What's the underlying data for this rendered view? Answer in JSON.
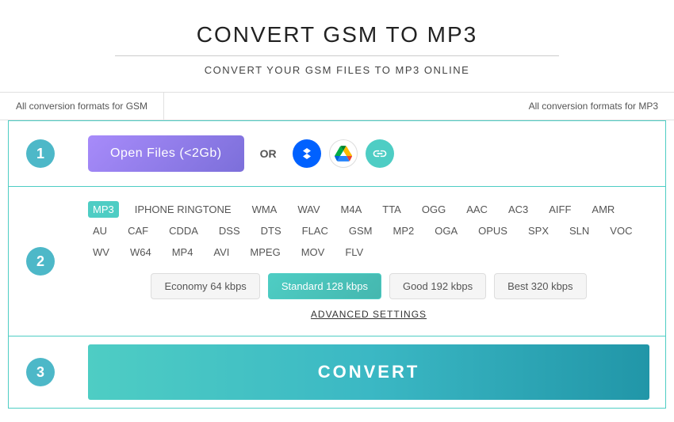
{
  "header": {
    "title": "CONVERT GSM TO MP3",
    "subtitle": "CONVERT YOUR GSM FILES TO MP3 ONLINE"
  },
  "tabs": [
    {
      "label": "All conversion formats for GSM"
    },
    {
      "label": "All conversion formats for MP3"
    }
  ],
  "step1": {
    "open_btn_label": "Open Files (<2Gb)",
    "or_label": "OR"
  },
  "step2": {
    "formats": [
      {
        "label": "MP3",
        "active": true
      },
      {
        "label": "IPHONE RINGTONE",
        "active": false
      },
      {
        "label": "WMA",
        "active": false
      },
      {
        "label": "WAV",
        "active": false
      },
      {
        "label": "M4A",
        "active": false
      },
      {
        "label": "TTA",
        "active": false
      },
      {
        "label": "OGG",
        "active": false
      },
      {
        "label": "AAC",
        "active": false
      },
      {
        "label": "AC3",
        "active": false
      },
      {
        "label": "AIFF",
        "active": false
      },
      {
        "label": "AMR",
        "active": false
      },
      {
        "label": "AU",
        "active": false
      },
      {
        "label": "CAF",
        "active": false
      },
      {
        "label": "CDDA",
        "active": false
      },
      {
        "label": "DSS",
        "active": false
      },
      {
        "label": "DTS",
        "active": false
      },
      {
        "label": "FLAC",
        "active": false
      },
      {
        "label": "GSM",
        "active": false
      },
      {
        "label": "MP2",
        "active": false
      },
      {
        "label": "OGA",
        "active": false
      },
      {
        "label": "OPUS",
        "active": false
      },
      {
        "label": "SPX",
        "active": false
      },
      {
        "label": "SLN",
        "active": false
      },
      {
        "label": "VOC",
        "active": false
      },
      {
        "label": "WV",
        "active": false
      },
      {
        "label": "W64",
        "active": false
      },
      {
        "label": "MP4",
        "active": false
      },
      {
        "label": "AVI",
        "active": false
      },
      {
        "label": "MPEG",
        "active": false
      },
      {
        "label": "MOV",
        "active": false
      },
      {
        "label": "FLV",
        "active": false
      }
    ],
    "quality_options": [
      {
        "label": "Economy 64 kbps",
        "active": false
      },
      {
        "label": "Standard 128 kbps",
        "active": true
      },
      {
        "label": "Good 192 kbps",
        "active": false
      },
      {
        "label": "Best 320 kbps",
        "active": false
      }
    ],
    "advanced_label": "ADVANCED SETTINGS"
  },
  "step3": {
    "convert_label": "CONVERT"
  },
  "steps": [
    "1",
    "2",
    "3"
  ]
}
